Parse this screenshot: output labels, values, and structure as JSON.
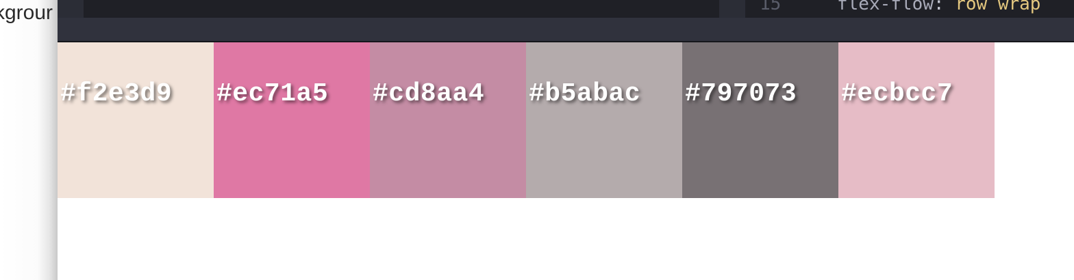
{
  "background_page": {
    "text": "kgrour"
  },
  "editor": {
    "line_number": "15",
    "code": {
      "property": "flex-flow",
      "separator": ": ",
      "value": "row wrap"
    },
    "colors": {
      "background": "#1f2026",
      "toolbar": "#30323d",
      "property": "#a8aab8",
      "value": "#e3c77f"
    }
  },
  "palette": {
    "swatches": [
      {
        "label": "#f2e3d9",
        "color": "#f2e3d9"
      },
      {
        "label": "#ec71a5",
        "color": "#df78a4"
      },
      {
        "label": "#cd8aa4",
        "color": "#c48ca4"
      },
      {
        "label": "#b5abac",
        "color": "#b4abac"
      },
      {
        "label": "#797073",
        "color": "#787174"
      },
      {
        "label": "#ecbcc7",
        "color": "#e6bcc6"
      }
    ]
  }
}
